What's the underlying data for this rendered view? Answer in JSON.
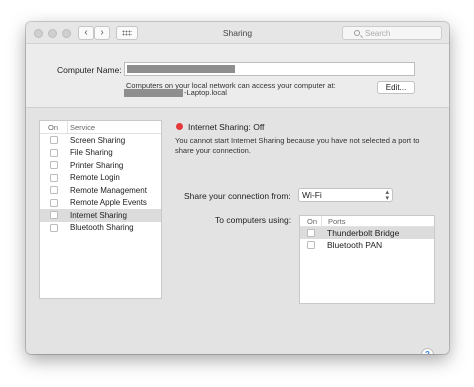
{
  "window": {
    "title": "Sharing",
    "nav_back": "‹",
    "nav_forward": "›",
    "search_placeholder": "Search"
  },
  "computer_name": {
    "label": "Computer Name:",
    "network_note": "Computers on your local network can access your computer at:",
    "hostname_suffix": "-Laptop.local",
    "edit_button": "Edit..."
  },
  "services": {
    "header_on": "On",
    "header_service": "Service",
    "items": [
      {
        "label": "Screen Sharing",
        "checked": false,
        "selected": false
      },
      {
        "label": "File Sharing",
        "checked": false,
        "selected": false
      },
      {
        "label": "Printer Sharing",
        "checked": false,
        "selected": false
      },
      {
        "label": "Remote Login",
        "checked": false,
        "selected": false
      },
      {
        "label": "Remote Management",
        "checked": false,
        "selected": false
      },
      {
        "label": "Remote Apple Events",
        "checked": false,
        "selected": false
      },
      {
        "label": "Internet Sharing",
        "checked": false,
        "selected": true
      },
      {
        "label": "Bluetooth Sharing",
        "checked": false,
        "selected": false
      }
    ]
  },
  "detail": {
    "status_color": "#e5383b",
    "status": "Internet Sharing: Off",
    "warning": "You cannot start Internet Sharing because you have not selected a port to share your connection.",
    "share_from_label": "Share your connection from:",
    "share_from_value": "Wi-Fi",
    "to_label": "To computers using:",
    "ports_header_on": "On",
    "ports_header_ports": "Ports",
    "ports": [
      {
        "label": "Thunderbolt Bridge",
        "checked": false,
        "selected": true
      },
      {
        "label": "Bluetooth PAN",
        "checked": false,
        "selected": false
      }
    ]
  },
  "help_label": "?"
}
